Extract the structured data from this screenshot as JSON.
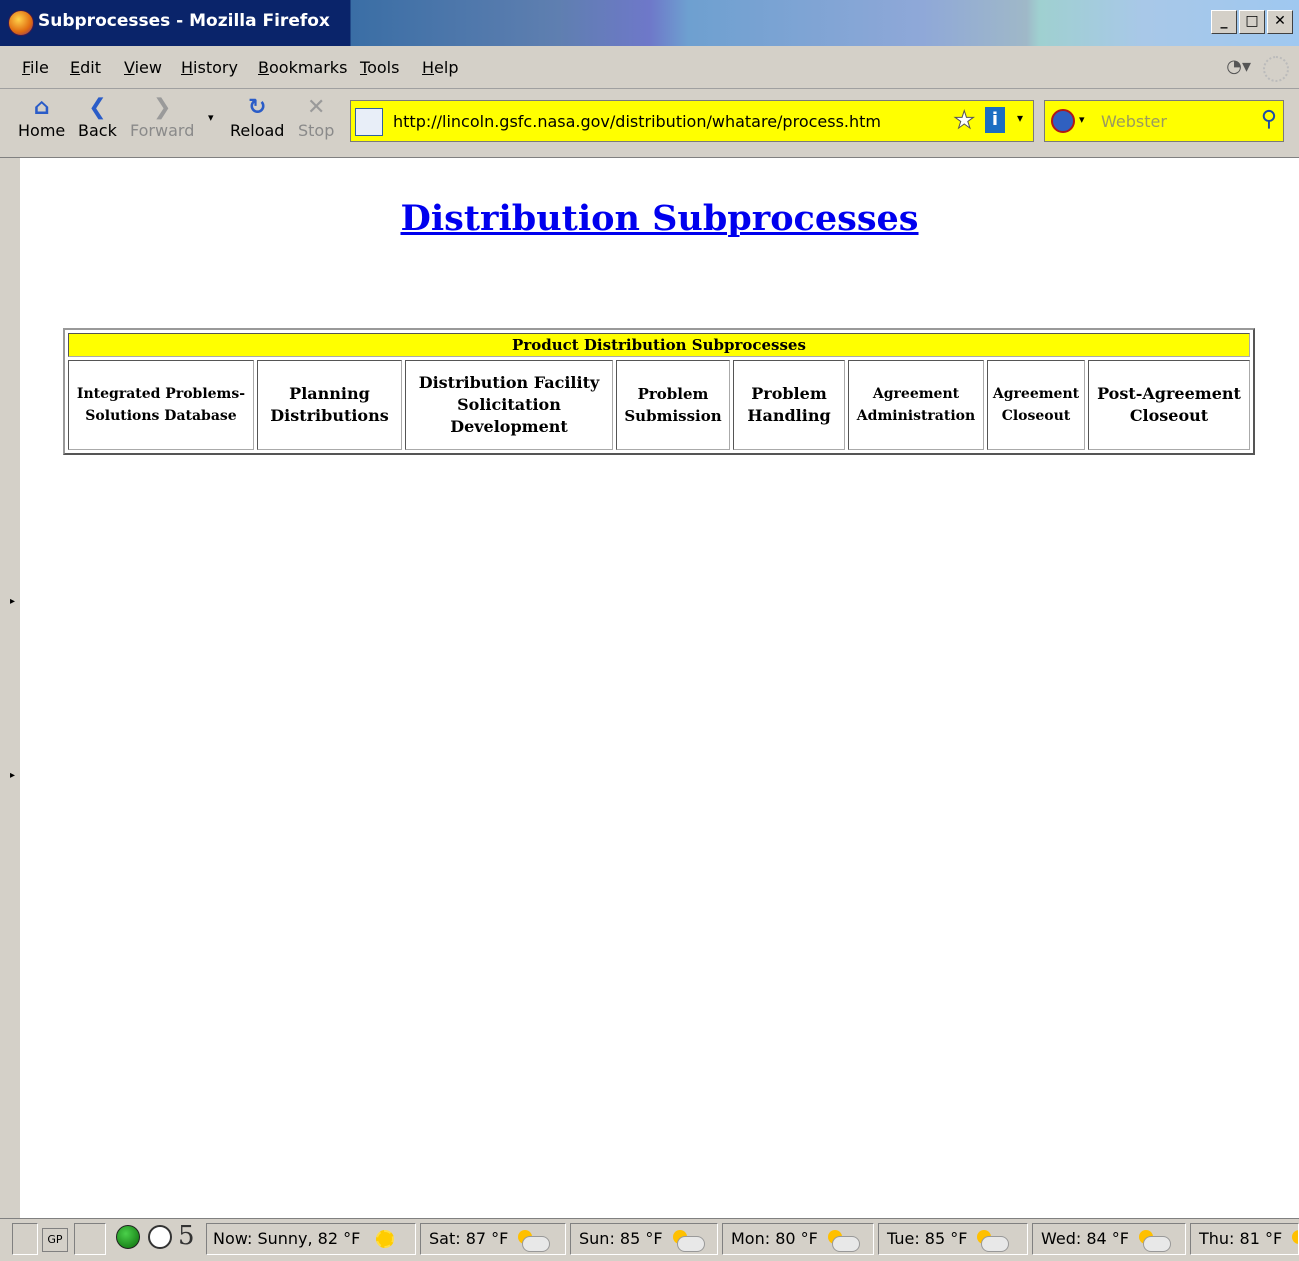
{
  "window": {
    "title": "Subprocesses - Mozilla Firefox",
    "controls": [
      "_",
      "□",
      "✕"
    ]
  },
  "menu": [
    "File",
    "Edit",
    "View",
    "History",
    "Bookmarks",
    "Tools",
    "Help"
  ],
  "nav": {
    "home": "Home",
    "back": "Back",
    "forward": "Forward",
    "reload": "Reload",
    "stop": "Stop"
  },
  "address": {
    "url": "http://lincoln.gsfc.nasa.gov/distribution/whatare/process.htm"
  },
  "search": {
    "placeholder": "Webster"
  },
  "page": {
    "title": "Distribution Subprocesses",
    "table_header": "Product Distribution Subprocesses",
    "cells": [
      {
        "line1": "Integrated Problems-",
        "line2": "Solutions Database"
      },
      {
        "line1": "Planning",
        "line2": "Distributions"
      },
      {
        "line1": "Distribution Facility",
        "line2": "Solicitation Development"
      },
      {
        "line1": "Problem",
        "line2": "Submission"
      },
      {
        "line1": "Problem",
        "line2": "Handling"
      },
      {
        "line1": "Agreement",
        "line2": "Administration"
      },
      {
        "line1": "Agreement",
        "line2": "Closeout"
      },
      {
        "line1": "Post-Agreement",
        "line2": "Closeout"
      }
    ]
  },
  "status": {
    "gp": "GP",
    "count": "5",
    "now": "Now: Sunny, 82 °F",
    "forecast": [
      "Sat: 87 °F",
      "Sun: 85 °F",
      "Mon: 80 °F",
      "Tue: 85 °F",
      "Wed: 84 °F",
      "Thu: 81 °F"
    ]
  },
  "colors": {
    "highlight": "#ffff00",
    "link": "#0000ee",
    "chrome": "#d4d0c8"
  }
}
